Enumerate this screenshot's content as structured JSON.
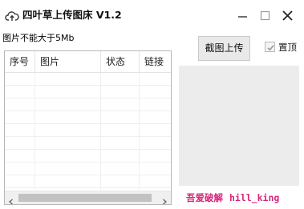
{
  "window": {
    "title": "四叶草上传图床 V1.2",
    "icons": {
      "app": "upload-cloud-icon",
      "minimize": "minimize-icon",
      "maximize": "maximize-icon",
      "close": "close-icon"
    }
  },
  "notice": {
    "size_limit": "图片不能大于5Mb"
  },
  "table": {
    "columns": [
      "序号",
      "图片",
      "状态",
      "链接"
    ],
    "rows": []
  },
  "toolbar": {
    "capture_label": "截图上传",
    "pin_label": "置顶",
    "pin_checked": true
  },
  "footer": {
    "site": "吾爱破解",
    "author": "hill_king",
    "color": "#d4267a"
  }
}
